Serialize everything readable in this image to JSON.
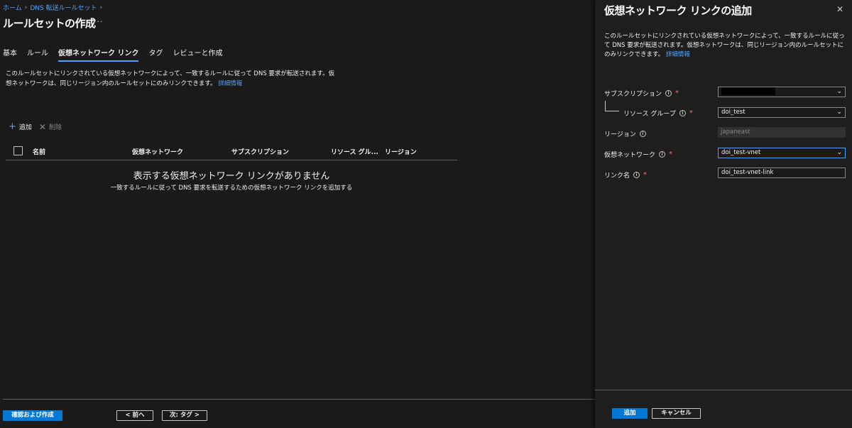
{
  "breadcrumb": [
    {
      "label": "ホーム"
    },
    {
      "label": "DNS 転送ルールセット"
    }
  ],
  "page": {
    "title": "ルールセットの作成",
    "more": "···"
  },
  "tabs": [
    {
      "label": "基本"
    },
    {
      "label": "ルール"
    },
    {
      "label": "仮想ネットワーク リンク"
    },
    {
      "label": "タグ"
    },
    {
      "label": "レビューと作成"
    }
  ],
  "description": {
    "text": "このルールセットにリンクされている仮想ネットワークによって、一致するルールに従って DNS 要求が転送されます。仮想ネットワークは、同じリージョン内のルールセットにのみリンクできます。",
    "link": "詳細情報"
  },
  "toolbar": {
    "add": "追加",
    "delete": "削除"
  },
  "table": {
    "columns": [
      "名前",
      "仮想ネットワーク",
      "サブスクリプション",
      "リソース グル...",
      "リージョン"
    ]
  },
  "empty": {
    "title": "表示する仮想ネットワーク リンクがありません",
    "subtitle": "一致するルールに従って DNS 要求を転送するための仮想ネットワーク リンクを追加する"
  },
  "footer": {
    "review_create": "確認および作成",
    "prev": "< 前へ",
    "next": "次: タグ >"
  },
  "panel": {
    "title": "仮想ネットワーク リンクの追加",
    "close": "✕",
    "description": "このルールセットにリンクされている仮想ネットワークによって、一致するルールに従って DNS 要求が転送されます。仮想ネットワークは、同じリージョン内のルールセットにのみリンクできます。",
    "link": "詳細情報",
    "fields": {
      "subscription": {
        "label": "サブスクリプション",
        "value": ""
      },
      "resource_group": {
        "label": "リソース グループ",
        "value": "doi_test"
      },
      "region": {
        "label": "リージョン",
        "value": "japaneast"
      },
      "vnet": {
        "label": "仮想ネットワーク",
        "value": "doi_test-vnet"
      },
      "link_name": {
        "label": "リンク名",
        "value": "doi_test-vnet-link"
      }
    },
    "add_button": "追加",
    "cancel_button": "キャンセル"
  },
  "icons": {
    "info": "info-icon",
    "chevron": "chevron-down-icon",
    "add": "plus-icon",
    "delete": "x-icon",
    "close": "close-icon"
  },
  "colors": {
    "accent": "#0078d4",
    "link": "#4fa3ff",
    "required": "#f1707b",
    "background": "#1b1a19"
  }
}
